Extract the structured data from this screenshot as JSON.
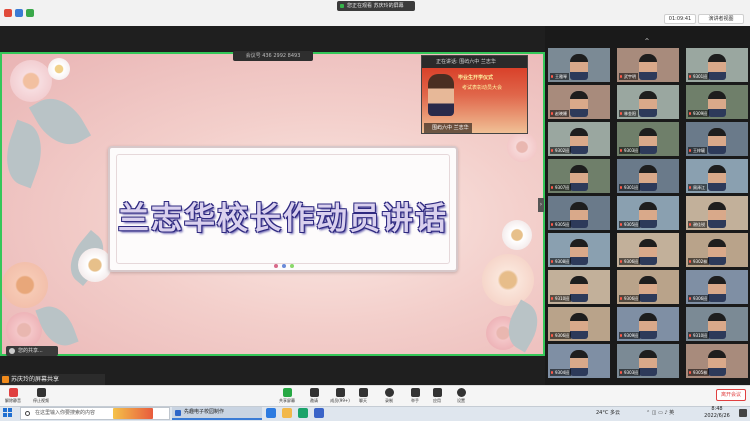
{
  "topbar": {
    "sharing_label": "您正在观看 苏庆玲的屏幕",
    "timer": "01:09:41",
    "view_button": "演讲者视图"
  },
  "share": {
    "meeting_id": "会议号 436 2992 8493",
    "banner_title": "兰志华校长作动员讲话",
    "control_label": "您的共享..."
  },
  "speaker": {
    "header": "正在讲话: 围屿六中 兰志华",
    "slide_title": "毕业生开学仪式",
    "slide_subtitle": "考试表彰动员大会",
    "name": "围屿六中 兰志华"
  },
  "gallery": {
    "participants": [
      "王雅琴",
      "武宇明",
      "9301班",
      "赵晓姗",
      "林金阳",
      "9309班",
      "9302班",
      "9303班",
      "王梓毓",
      "9307班",
      "9301班",
      "周泽江",
      "9305班",
      "9305班",
      "谢佳锐",
      "9308班",
      "9306班",
      "9302林",
      "9310班",
      "9306班",
      "9306班",
      "9306班",
      "9309班",
      "9310班",
      "9304班",
      "9303班",
      "9305林"
    ]
  },
  "notice": "苏庆玲的屏幕共享",
  "toolbar": {
    "items": [
      "解除静音",
      "停止视频",
      "共享屏幕",
      "邀请",
      "成员(99+)",
      "聊天",
      "录制",
      "举手",
      "应用",
      "设置"
    ],
    "leave": "离开会议"
  },
  "taskbar": {
    "search_placeholder": "在这里输入你要搜索的内容",
    "active_app": "先趣电子校园制作",
    "weather": "24°C 多云",
    "time": "8:48",
    "date": "2022/6/26"
  },
  "colors": {
    "accent_green": "#34c759",
    "leave_red": "#e04040",
    "banner_text": "#2f2a80"
  }
}
